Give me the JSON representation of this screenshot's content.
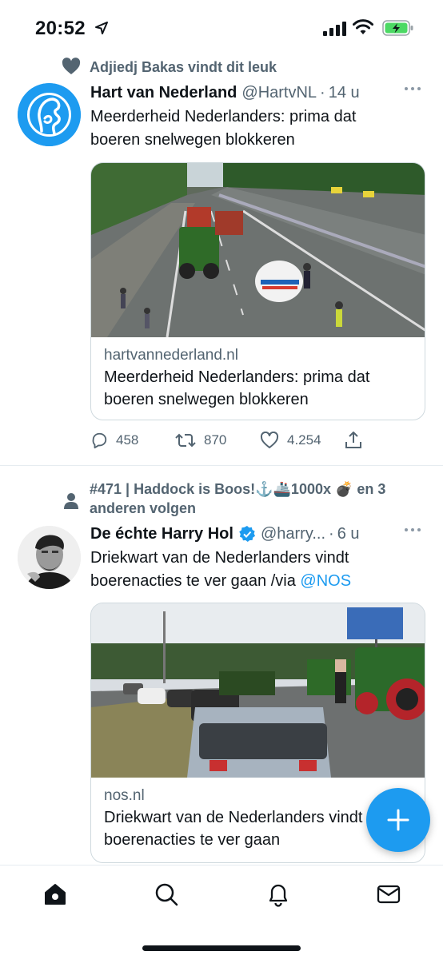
{
  "status_bar": {
    "time": "20:52",
    "battery_color": "#4cd964"
  },
  "tweets": [
    {
      "social_context": "Adjiedj Bakas vindt dit leuk",
      "social_icon": "heart-icon",
      "author_name": "Hart van Nederland",
      "handle": "@HartvNL",
      "time": "14 u",
      "text": "Meerderheid Nederlanders: prima dat boeren snelwegen blokkeren",
      "card": {
        "domain": "hartvannederland.nl",
        "title": "Meerderheid Nederlanders: prima dat boeren snelwegen blokkeren"
      },
      "actions": {
        "replies": "458",
        "retweets": "870",
        "likes": "4.254"
      }
    },
    {
      "social_context_line1": "#471 | Haddock is Boos!⚓️🚢1000x 💣 en 3",
      "social_context_line2": "anderen volgen",
      "social_icon": "person-icon",
      "author_name": "De échte Harry Hol",
      "verified": true,
      "handle": "@harry...",
      "time": "6 u",
      "text": "Driekwart van de Nederlanders vindt boerenacties te ver gaan /via ",
      "mention": "@NOS",
      "card": {
        "domain": "nos.nl",
        "title": "Driekwart van de Nederlanders vindt boerenacties te ver gaan"
      }
    }
  ],
  "colors": {
    "accent": "#1d9bf0",
    "secondary_text": "#536471",
    "primary_text": "#0f1419"
  },
  "nav": [
    "home-icon",
    "search-icon",
    "notifications-icon",
    "messages-icon"
  ]
}
